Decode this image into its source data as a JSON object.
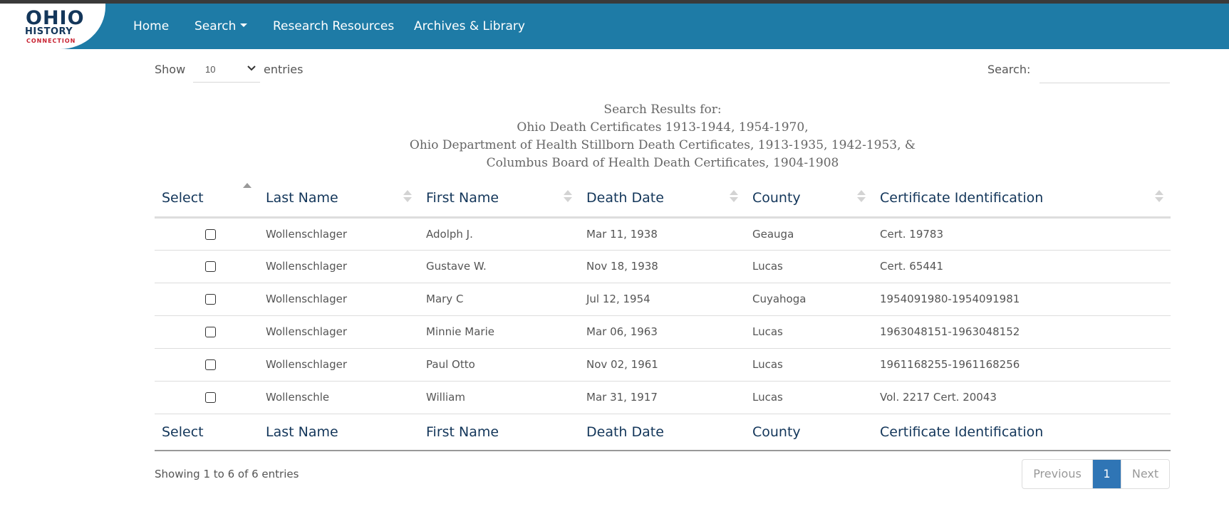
{
  "logo": {
    "line1": "OHIO",
    "line2": "HISTORY",
    "line3": "CONNECTION"
  },
  "nav": {
    "home": "Home",
    "search": "Search",
    "research": "Research Resources",
    "archives": "Archives & Library"
  },
  "controls": {
    "show_label": "Show",
    "show_value": "10",
    "entries_label": "entries",
    "search_label": "Search:",
    "search_value": ""
  },
  "results_title": [
    "Search Results for:",
    "Ohio Death Certificates 1913-1944, 1954-1970,",
    "Ohio Department of Health Stillborn Death Certificates, 1913-1935, 1942-1953, &",
    "Columbus Board of Health Death Certificates, 1904-1908"
  ],
  "table": {
    "columns": [
      "Select",
      "Last Name",
      "First Name",
      "Death Date",
      "County",
      "Certificate Identification"
    ],
    "rows": [
      {
        "last": "Wollenschlager",
        "first": "Adolph J.",
        "date": "Mar 11, 1938",
        "county": "Geauga",
        "cert": "Cert. 19783",
        "checked": false
      },
      {
        "last": "Wollenschlager",
        "first": "Gustave W.",
        "date": "Nov 18, 1938",
        "county": "Lucas",
        "cert": "Cert. 65441",
        "checked": false
      },
      {
        "last": "Wollenschlager",
        "first": "Mary C",
        "date": "Jul 12, 1954",
        "county": "Cuyahoga",
        "cert": "1954091980-1954091981",
        "checked": false
      },
      {
        "last": "Wollenschlager",
        "first": "Minnie Marie",
        "date": "Mar 06, 1963",
        "county": "Lucas",
        "cert": "1963048151-1963048152",
        "checked": false
      },
      {
        "last": "Wollenschlager",
        "first": "Paul Otto",
        "date": "Nov 02, 1961",
        "county": "Lucas",
        "cert": "1961168255-1961168256",
        "checked": false
      },
      {
        "last": "Wollenschle",
        "first": "William",
        "date": "Mar 31, 1917",
        "county": "Lucas",
        "cert": "Vol. 2217 Cert. 20043",
        "checked": false
      }
    ]
  },
  "info": "Showing 1 to 6 of 6 entries",
  "pagination": {
    "previous": "Previous",
    "current": "1",
    "next": "Next"
  },
  "colors": {
    "navbar": "#1e7ba6",
    "header_text": "#13365a",
    "active_page": "#2f75b5"
  }
}
